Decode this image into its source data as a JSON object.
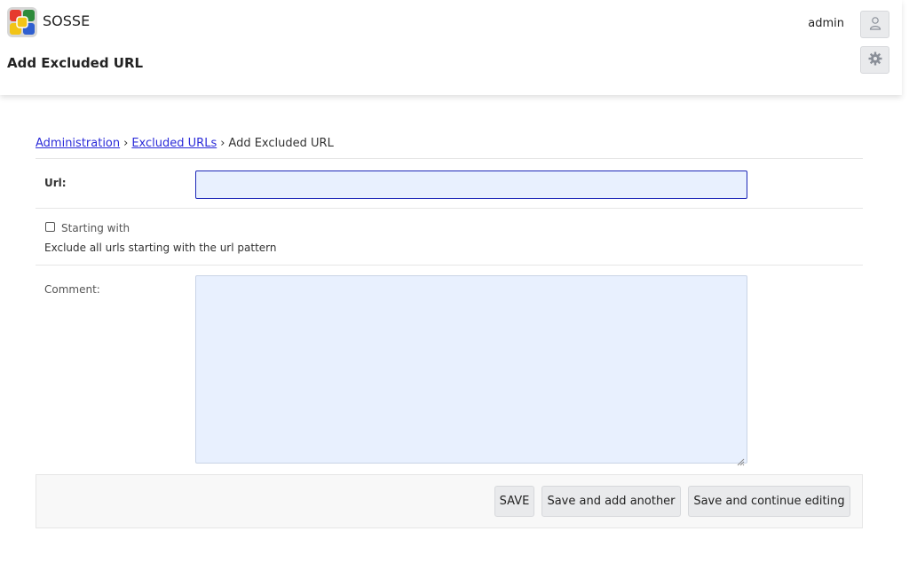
{
  "header": {
    "app_name": "SOSSE",
    "page_title": "Add Excluded URL",
    "username": "admin"
  },
  "breadcrumb": {
    "items": [
      "Administration",
      "Excluded URLs",
      "Add Excluded URL"
    ],
    "separator": "›"
  },
  "form": {
    "url_label": "Url:",
    "url_value": "",
    "starting_with_label": "Starting with",
    "starting_with_checked": false,
    "starting_with_help": "Exclude all urls starting with the url pattern",
    "comment_label": "Comment:",
    "comment_value": ""
  },
  "actions": {
    "save": "SAVE",
    "save_add_another": "Save and add another",
    "save_continue": "Save and continue editing"
  },
  "icons": {
    "user": "user-icon",
    "settings": "gear-icon",
    "logo": "sosse-logo"
  },
  "colors": {
    "link": "#2b2bd9",
    "input_bg": "#e8f0fe",
    "input_focus_border": "#1d27b8",
    "button_bg": "#e9eaec"
  }
}
